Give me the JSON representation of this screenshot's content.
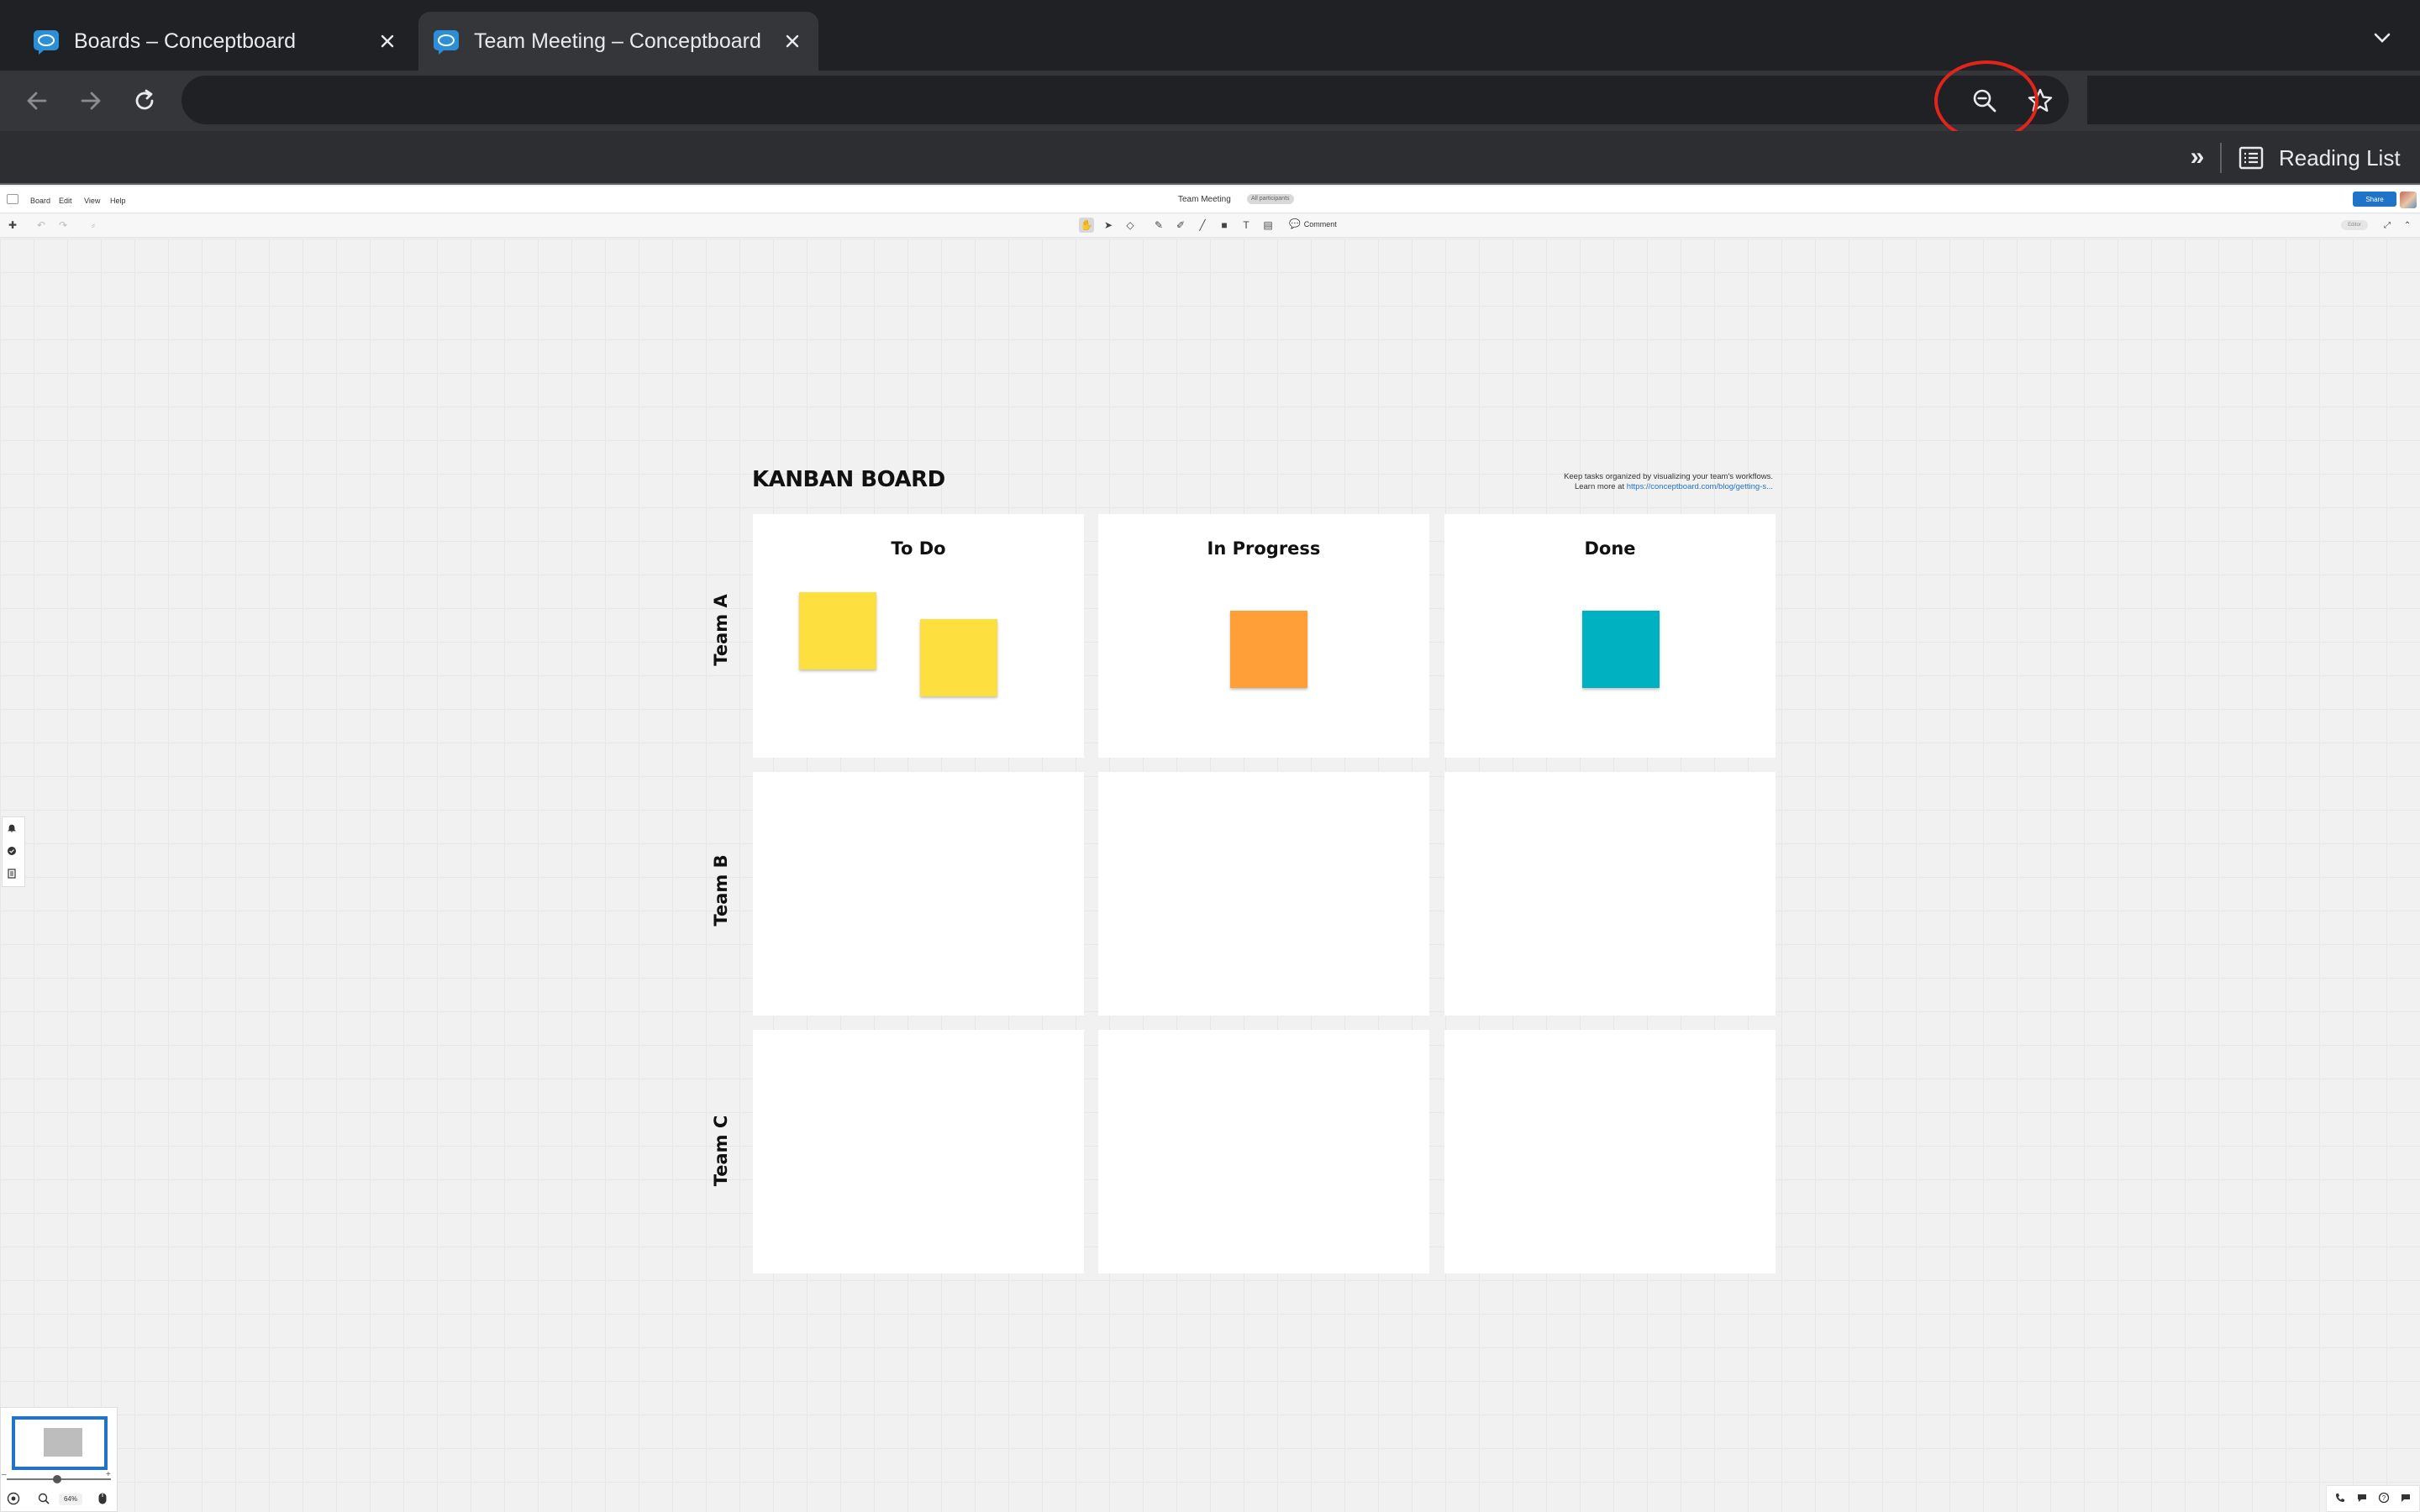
{
  "browser": {
    "tabs": [
      {
        "title": "Boards – Conceptboard",
        "active": false
      },
      {
        "title": "Team Meeting – Conceptboard",
        "active": true
      }
    ],
    "omnibox_url": "",
    "reading_list_label": "Reading List",
    "bookmarks_overflow": "»"
  },
  "app": {
    "menu": [
      "Board",
      "Edit",
      "View",
      "Help"
    ],
    "board_title": "Team Meeting",
    "participants_label": "All participants",
    "share_label": "Share",
    "comment_label": "Comment",
    "editor_badge": "Editor",
    "zoom_level": "64%"
  },
  "kanban": {
    "title": "KANBAN BOARD",
    "description_line1": "Keep tasks organized by visualizing your team's workflows.",
    "description_line2_prefix": "Learn more at ",
    "description_link": "https://conceptboard.com/blog/getting-s...",
    "columns": [
      "To Do",
      "In Progress",
      "Done"
    ],
    "rows": [
      "Team A",
      "Team B",
      "Team C"
    ],
    "sticky_notes": [
      {
        "column": "To Do",
        "row": "Team A",
        "color": "#fde03f"
      },
      {
        "column": "To Do",
        "row": "Team A",
        "color": "#fde03f"
      },
      {
        "column": "In Progress",
        "row": "Team A",
        "color": "#ff9f38"
      },
      {
        "column": "Done",
        "row": "Team A",
        "color": "#00b1c1"
      }
    ]
  },
  "colors": {
    "accent": "#1f73c9",
    "highlight_ring": "#e3241b",
    "tab_bar": "#202124",
    "canvas": "#f1f1f1"
  }
}
